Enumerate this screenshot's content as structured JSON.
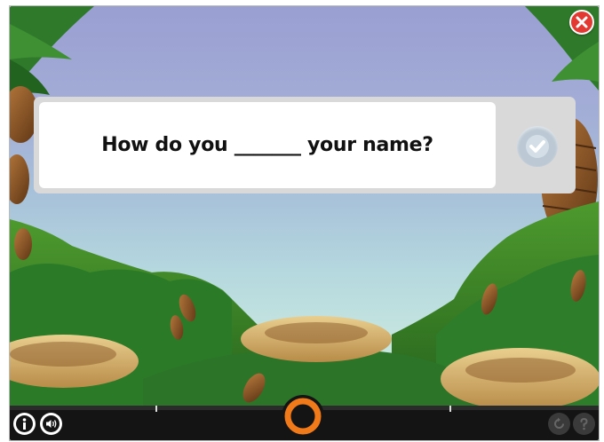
{
  "question": {
    "text": "How do you _______ your name?"
  },
  "colors": {
    "close": "#e23a32",
    "progress_ring": "#f07a1a",
    "check": "#bcc9d4"
  },
  "icons": {
    "close": "close-icon",
    "check": "checkmark-icon",
    "info": "info-icon",
    "sound": "speaker-icon",
    "replay": "replay-icon",
    "help": "help-icon"
  }
}
